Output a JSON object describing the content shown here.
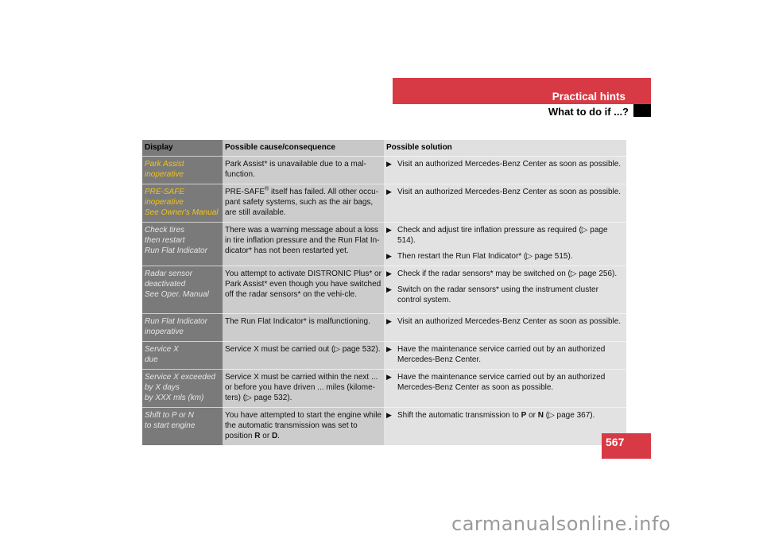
{
  "header": {
    "section_title": "Practical hints",
    "subsection_title": "What to do if ...?"
  },
  "table": {
    "columns": [
      "Display",
      "Possible cause/consequence",
      "Possible solution"
    ],
    "rows": [
      {
        "display_lines": [
          "Park Assist",
          "inoperative"
        ],
        "display_color": "yellow",
        "cause": "Park Assist* is unavailable due to a mal-function.",
        "solutions": [
          "Visit an authorized Mercedes-Benz Center as soon as possible."
        ]
      },
      {
        "display_lines": [
          "PRE-SAFE",
          "inoperative",
          "See Owner's Manual"
        ],
        "display_color": "yellow",
        "cause_prefix": "PRE-SAFE",
        "cause_sup": "®",
        "cause": " itself has failed. All other occu-pant safety systems, such as the air bags, are still available.",
        "solutions": [
          "Visit an authorized Mercedes-Benz Center as soon as possible."
        ]
      },
      {
        "display_lines": [
          "Check tires",
          "then restart",
          "Run Flat Indicator"
        ],
        "display_color": "white",
        "cause": "There was a warning message about a loss in tire inflation pressure and the Run Flat In-dicator* has not been restarted yet.",
        "solutions": [
          "Check and adjust tire inflation pressure as required (▷ page 514).",
          "Then restart the Run Flat Indicator* (▷ page 515)."
        ]
      },
      {
        "display_lines": [
          "Radar sensor",
          "deactivated",
          "See Oper. Manual"
        ],
        "display_color": "white",
        "cause": "You attempt to activate DISTRONIC Plus* or Park Assist* even though you have switched off the radar sensors* on the vehi-cle.",
        "solutions": [
          "Check if the radar sensors* may be switched on (▷ page 256).",
          "Switch on the radar sensors* using the instrument cluster control system."
        ]
      },
      {
        "display_lines": [
          "Run Flat Indicator",
          "inoperative"
        ],
        "display_color": "white",
        "cause": "The Run Flat Indicator* is malfunctioning.",
        "solutions": [
          "Visit an authorized Mercedes-Benz Center as soon as possible."
        ]
      },
      {
        "display_lines": [
          "Service X",
          "due"
        ],
        "display_color": "white",
        "cause": "Service X must be carried out (▷ page 532).",
        "solutions": [
          "Have the maintenance service carried out by an authorized Mercedes-Benz Center."
        ]
      },
      {
        "display_lines": [
          "Service X exceeded",
          "by X days",
          "by XXX mls (km)"
        ],
        "display_color": "white",
        "cause": "Service X must be carried within the next ... or before you have driven ... miles (kilome-ters) (▷ page 532).",
        "solutions": [
          "Have the maintenance service carried out by an authorized Mercedes-Benz Center as soon as possible."
        ]
      },
      {
        "display_lines": [
          "Shift to P or N",
          "to start engine"
        ],
        "display_color": "white",
        "cause_parts": [
          "You have attempted to start the engine while the automatic transmission was set to position ",
          "R",
          " or ",
          "D",
          "."
        ],
        "solution_parts": [
          "Shift the automatic transmission to ",
          "P",
          " or ",
          "N",
          " (▷ page 367)."
        ]
      }
    ]
  },
  "bullet_glyph": "▶",
  "page_number": "567",
  "watermark": "carmanualsonline.info",
  "colors": {
    "accent_red": "#d83a45",
    "warning_yellow": "#f3c317"
  }
}
